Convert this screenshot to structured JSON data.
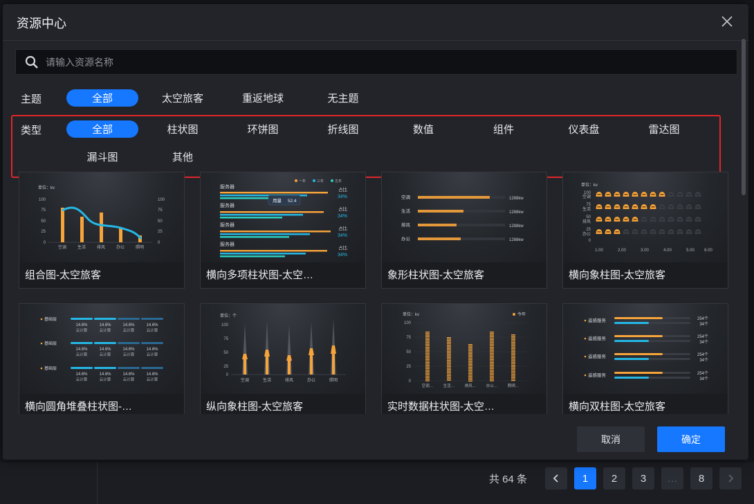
{
  "dialog": {
    "title": "资源中心"
  },
  "search": {
    "placeholder": "请输入资源名称"
  },
  "filters": {
    "theme": {
      "label": "主题",
      "options": [
        "全部",
        "太空旅客",
        "重返地球",
        "无主题"
      ]
    },
    "type": {
      "label": "类型",
      "options": [
        "全部",
        "柱状图",
        "环饼图",
        "折线图",
        "数值",
        "组件",
        "仪表盘",
        "雷达图",
        "漏斗图",
        "其他"
      ]
    }
  },
  "cards": [
    {
      "name": "组合图-太空旅客",
      "unit": "单位：kv",
      "yticks": [
        "100",
        "75",
        "50",
        "25",
        "0"
      ],
      "cats": [
        "空调",
        "生活",
        "排风",
        "办公",
        "照明"
      ]
    },
    {
      "name": "横向多项柱状图-太空…",
      "legend": [
        "一年",
        "三年",
        "五年"
      ],
      "rows": [
        "服务器",
        "服务器",
        "服务器",
        "服务器"
      ],
      "tag": "占比",
      "pct": "34%",
      "tooltip_label": "用量",
      "tooltip_value": "52.4"
    },
    {
      "name": "象形柱状图-太空旅客",
      "rows": [
        "空调",
        "生活",
        "排风",
        "办公"
      ],
      "value": "1288kw"
    },
    {
      "name": "横向象柱图-太空旅客",
      "unit": "单位：kv",
      "yticks": [
        "100",
        "75",
        "50",
        "25",
        "0"
      ],
      "rows": [
        "空调",
        "生活",
        "排风",
        "办公"
      ],
      "xticks": [
        "1.00",
        "2.00",
        "3.00",
        "4.00",
        "5.00",
        "6.00"
      ]
    },
    {
      "name": "横向圆角堆叠柱状图-…",
      "rows": [
        "基础层",
        "基础层",
        "基础层"
      ],
      "pct": "14.6%",
      "sub": "云计算"
    },
    {
      "name": "纵向象柱图-太空旅客",
      "unit": "单位：个",
      "yticks": [
        "100",
        "75",
        "50",
        "25",
        "0"
      ],
      "cats": [
        "空调",
        "生活",
        "排风",
        "办公",
        "照明"
      ]
    },
    {
      "name": "实时数据柱状图-太空…",
      "unit": "单位：kv",
      "legend": "今年",
      "yticks": [
        "100",
        "75",
        "50",
        "25",
        "0"
      ],
      "cats": [
        "空调…",
        "生活…",
        "排风…",
        "办公…",
        "照明…"
      ]
    },
    {
      "name": "横向双柱图-太空旅客",
      "rows": [
        "遥感服务",
        "遥感服务",
        "遥感服务",
        "遥感服务"
      ],
      "v1": "254个",
      "v2": "34个"
    }
  ],
  "actions": {
    "cancel": "取消",
    "ok": "确定"
  },
  "pager": {
    "total": "共 64 条",
    "pages": [
      "1",
      "2",
      "3",
      "…",
      "8"
    ]
  },
  "colors": {
    "accent": "#1677ff",
    "orange": "#f5a33b",
    "cyan": "#25b8e6",
    "highlight": "#e0262a"
  }
}
